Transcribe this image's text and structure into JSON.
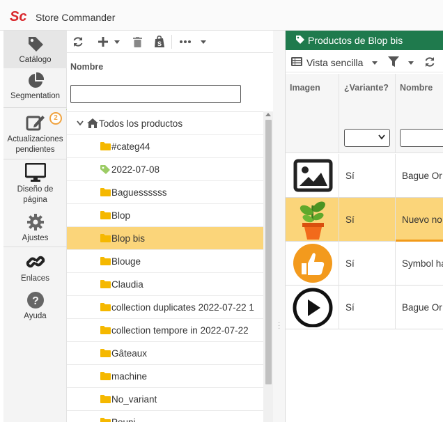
{
  "app": {
    "title": "Store Commander",
    "logo_text": "Sc",
    "logo_color": "#d9262b"
  },
  "sidebar": {
    "items": [
      {
        "label": "Catálogo",
        "icon": "tag-icon",
        "active": true
      },
      {
        "label": "Segmentation",
        "icon": "pie-chart-icon",
        "active": false
      },
      {
        "label": "Actualizaciones pendientes",
        "label_line1": "Actualizaciones",
        "label_line2": "pendientes",
        "icon": "edit-icon",
        "badge": "2"
      },
      {
        "label": "Diseño de página",
        "label_line1": "Diseño de",
        "label_line2": "página",
        "icon": "monitor-icon"
      },
      {
        "label": "Ajustes",
        "icon": "gear-icon"
      },
      {
        "label": "Enlaces",
        "icon": "link-icon"
      },
      {
        "label": "Ayuda",
        "icon": "help-icon"
      }
    ]
  },
  "tree": {
    "toolbar": {
      "refresh": "refresh-icon",
      "add": "plus-icon",
      "delete": "trash-icon",
      "shop": "shopify-icon",
      "more": "more-icon"
    },
    "column_header": "Nombre",
    "filter_value": "",
    "root_label": "Todos los productos",
    "items": [
      {
        "label": "#categ44",
        "icon": "folder-icon"
      },
      {
        "label": "2022-07-08",
        "icon": "tag-icon"
      },
      {
        "label": "Baguessssss",
        "icon": "folder-icon"
      },
      {
        "label": "Blop",
        "icon": "folder-icon"
      },
      {
        "label": "Blop bis",
        "icon": "folder-icon",
        "selected": true
      },
      {
        "label": "Blouge",
        "icon": "folder-icon"
      },
      {
        "label": "Claudia",
        "icon": "folder-icon"
      },
      {
        "label": "collection duplicates 2022-07-22 1",
        "icon": "folder-icon"
      },
      {
        "label": "collection tempore in 2022-07-22",
        "icon": "folder-icon"
      },
      {
        "label": "Gâteaux",
        "icon": "folder-icon"
      },
      {
        "label": "machine",
        "icon": "folder-icon"
      },
      {
        "label": "No_variant",
        "icon": "folder-icon"
      },
      {
        "label": "Pouni",
        "icon": "folder-icon"
      }
    ]
  },
  "products": {
    "panel_title": "Productos de Blop bis",
    "view_label": "Vista sencilla",
    "columns": {
      "image": "Imagen",
      "variant": "¿Variante?",
      "name": "Nombre"
    },
    "variant_filter": "",
    "name_filter": "",
    "rows": [
      {
        "image": "image-placeholder-icon",
        "variant": "Sí",
        "name": "Bague Or"
      },
      {
        "image": "potted-plant-icon",
        "variant": "Sí",
        "name": "Nuevo no",
        "selected": true
      },
      {
        "image": "thumbs-up-icon",
        "variant": "Sí",
        "name": "Symbol ha"
      },
      {
        "image": "play-icon",
        "variant": "Sí",
        "name": "Bague Or"
      }
    ]
  },
  "colors": {
    "accent_green": "#1f7a4d",
    "selection": "#fbd57a",
    "badge": "#f0a340",
    "folder": "#f5b800"
  }
}
